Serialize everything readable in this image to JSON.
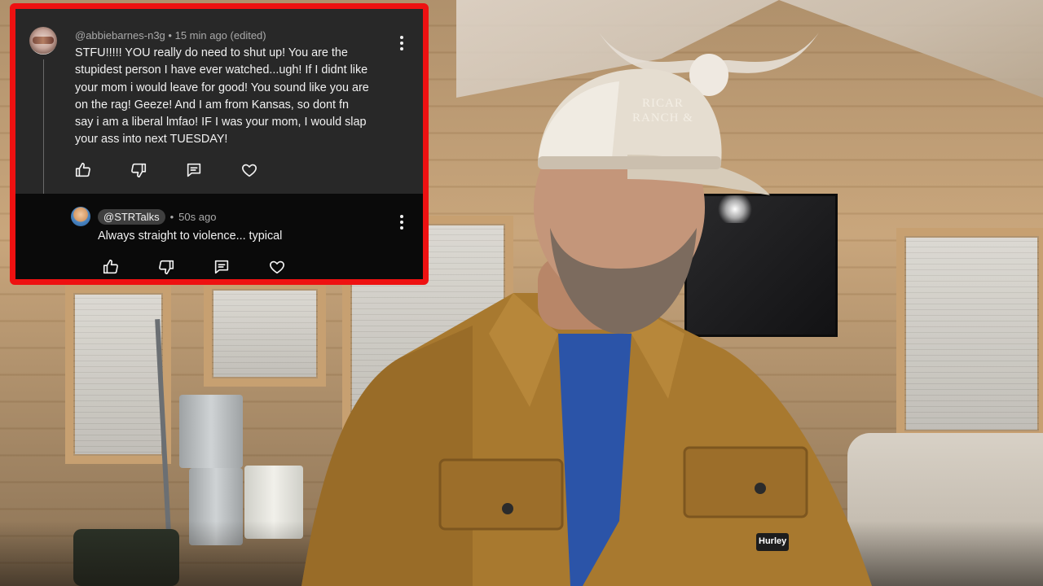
{
  "comment": {
    "author": "@abbiebarnes-n3g",
    "separator": "•",
    "time": "15 min ago (edited)",
    "lines": [
      "STFU!!!!!  YOU really do need to shut up! You are the",
      "stupidest person I have ever watched...ugh!  If I didnt like",
      "your mom i would leave for good! You sound like you are",
      "on the rag!  Geeze!  And I am from Kansas, so dont fn",
      "say i am a liberal lmfao!  IF I was your mom, I would slap",
      "your ass into next TUESDAY!"
    ],
    "actions": [
      "thumbs-up-icon",
      "thumbs-down-icon",
      "reply-comment-icon",
      "heart-icon"
    ]
  },
  "reply": {
    "author": "@STRTalks",
    "separator": "•",
    "time": "50s ago",
    "text": "Always straight to violence... typical",
    "actions": [
      "thumbs-up-icon",
      "thumbs-down-icon",
      "reply-comment-icon",
      "heart-icon"
    ]
  },
  "background": {
    "cap_text_line1": "RICAR",
    "cap_text_line2": "RANCH &",
    "jacket_tag": "Hurley"
  },
  "colors": {
    "overlay_border": "#ee1111",
    "comment_bg": "#282828",
    "reply_bg": "#0a0a0a",
    "text_primary": "#f1f1f1",
    "text_secondary": "#aaaaaa"
  }
}
